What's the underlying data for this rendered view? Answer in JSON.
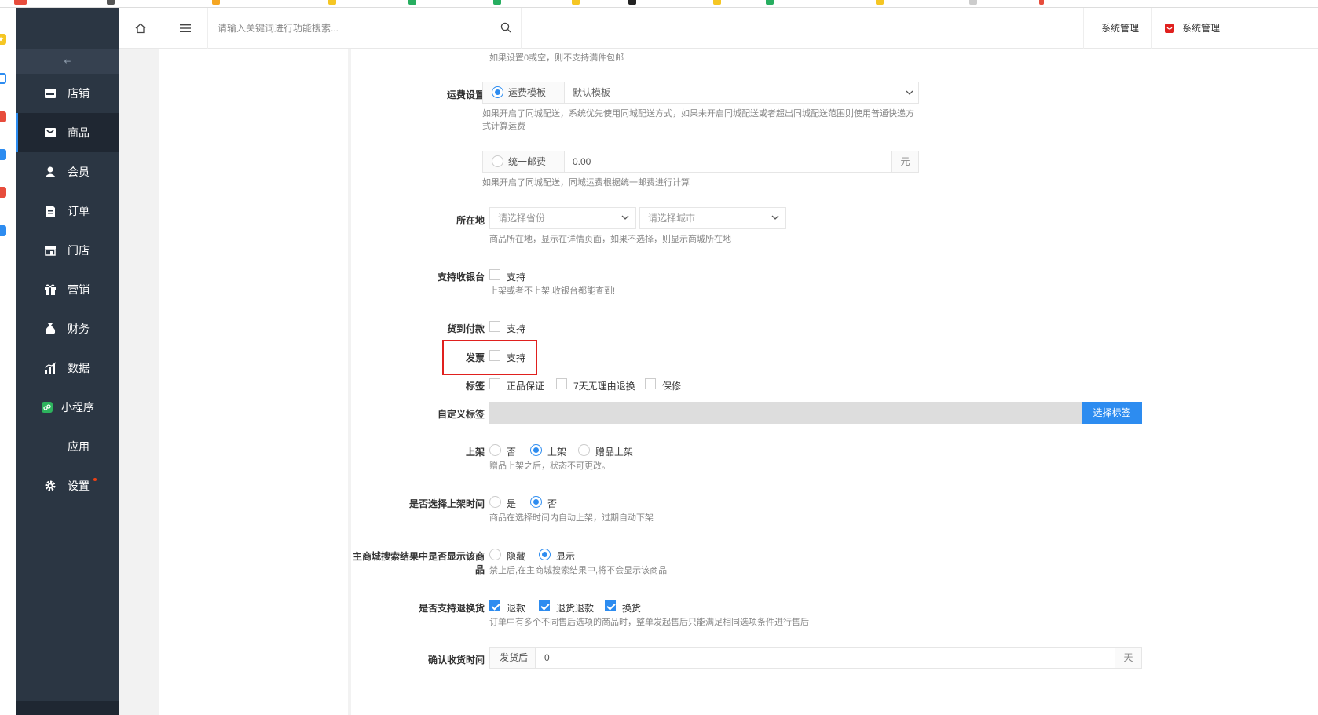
{
  "topbar": {
    "search_placeholder": "请输入关键词进行功能搜索...",
    "right_item_1": "系统管理",
    "right_item_2": "系统管理"
  },
  "sidebar": {
    "fold_symbol": "⇤",
    "items": [
      {
        "label": "店铺",
        "icon": "store-icon"
      },
      {
        "label": "商品",
        "icon": "goods-icon"
      },
      {
        "label": "会员",
        "icon": "member-icon"
      },
      {
        "label": "订单",
        "icon": "order-icon"
      },
      {
        "label": "门店",
        "icon": "shop-icon"
      },
      {
        "label": "营销",
        "icon": "gift-icon"
      },
      {
        "label": "财务",
        "icon": "money-bag-icon"
      },
      {
        "label": "数据",
        "icon": "chart-icon"
      },
      {
        "label": "小程序",
        "icon": "miniapp-icon"
      },
      {
        "label": "应用",
        "icon": "app-icon"
      },
      {
        "label": "设置",
        "icon": "gear-icon"
      }
    ],
    "active_index": 1
  },
  "form": {
    "top_help": "如果设置0或空，则不支持满件包邮",
    "shipping": {
      "label": "运费设置",
      "template_option": "运费模板",
      "template_value": "默认模板",
      "template_help": "如果开启了同城配送，系统优先使用同城配送方式，如果未开启同城配送或者超出同城配送范围则使用普通快递方式计算运费",
      "flat_option": "统一邮费",
      "flat_value": "0.00",
      "flat_unit": "元",
      "flat_help": "如果开启了同城配送，同城运费根据统一邮费进行计算"
    },
    "location": {
      "label": "所在地",
      "province_placeholder": "请选择省份",
      "city_placeholder": "请选择城市",
      "help": "商品所在地，显示在详情页面，如果不选择，则显示商城所在地"
    },
    "cashier": {
      "label": "支持收银台",
      "option": "支持",
      "help": "上架或者不上架,收银台都能查到!"
    },
    "cod": {
      "label": "货到付款",
      "option": "支持"
    },
    "invoice": {
      "label": "发票",
      "option": "支持"
    },
    "tags": {
      "label": "标签",
      "options": [
        "正品保证",
        "7天无理由退换",
        "保修"
      ]
    },
    "custom_tags": {
      "label": "自定义标签",
      "button": "选择标签"
    },
    "listing": {
      "label": "上架",
      "options": [
        "否",
        "上架",
        "赠品上架"
      ],
      "selected": 1,
      "help": "赠品上架之后，状态不可更改。"
    },
    "schedule": {
      "label": "是否选择上架时间",
      "options": [
        "是",
        "否"
      ],
      "selected": 1,
      "help": "商品在选择时间内自动上架，过期自动下架"
    },
    "search_visibility": {
      "label": "主商城搜索结果中是否显示该商品",
      "options": [
        "隐藏",
        "显示"
      ],
      "selected": 1,
      "help": "禁止后,在主商城搜索结果中,将不会显示该商品"
    },
    "returns": {
      "label": "是否支持退换货",
      "options": [
        "退款",
        "退货退款",
        "换货"
      ],
      "help": "订单中有多个不同售后选项的商品时，整单发起售后只能满足相同选项条件进行售后"
    },
    "confirm_time": {
      "label": "确认收货时间",
      "prefix": "发货后",
      "value": "0",
      "unit": "天"
    }
  },
  "colors": {
    "sidebar_bg": "#2b3643",
    "accent": "#2d8cf0",
    "highlight": "#e0201e"
  }
}
